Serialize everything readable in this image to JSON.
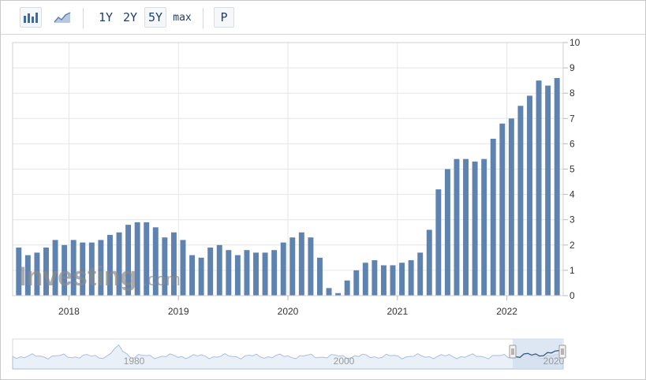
{
  "toolbar": {
    "range_buttons": [
      "1Y",
      "2Y",
      "5Y",
      "max"
    ],
    "active_range": "5Y",
    "print_label": "P"
  },
  "watermark": {
    "brand": "Investing",
    "suffix": ".com"
  },
  "colors": {
    "bar": "#5f83b1",
    "grid": "#e6e6e6",
    "navigator_line": "#a9bfdd",
    "navigator_mask": "#cfdcee",
    "active_button_bg": "#e9eef5"
  },
  "icons": {
    "bar_chart": "bar-chart-icon",
    "line_chart": "line-chart-icon"
  },
  "chart_data": {
    "type": "bar",
    "x": [
      "2017-07",
      "2017-08",
      "2017-09",
      "2017-10",
      "2017-11",
      "2017-12",
      "2018-01",
      "2018-02",
      "2018-03",
      "2018-04",
      "2018-05",
      "2018-06",
      "2018-07",
      "2018-08",
      "2018-09",
      "2018-10",
      "2018-11",
      "2018-12",
      "2019-01",
      "2019-02",
      "2019-03",
      "2019-04",
      "2019-05",
      "2019-06",
      "2019-07",
      "2019-08",
      "2019-09",
      "2019-10",
      "2019-11",
      "2019-12",
      "2020-01",
      "2020-02",
      "2020-03",
      "2020-04",
      "2020-05",
      "2020-06",
      "2020-07",
      "2020-08",
      "2020-09",
      "2020-10",
      "2020-11",
      "2020-12",
      "2021-01",
      "2021-02",
      "2021-03",
      "2021-04",
      "2021-05",
      "2021-06",
      "2021-07",
      "2021-08",
      "2021-09",
      "2021-10",
      "2021-11",
      "2021-12",
      "2022-01",
      "2022-02",
      "2022-03",
      "2022-04",
      "2022-05",
      "2022-06"
    ],
    "values": [
      1.9,
      1.6,
      1.7,
      1.9,
      2.2,
      2.0,
      2.2,
      2.1,
      2.1,
      2.2,
      2.4,
      2.5,
      2.8,
      2.9,
      2.9,
      2.7,
      2.3,
      2.5,
      2.2,
      1.6,
      1.5,
      1.9,
      2.0,
      1.8,
      1.6,
      1.8,
      1.7,
      1.7,
      1.8,
      2.1,
      2.3,
      2.5,
      2.3,
      1.5,
      0.3,
      0.1,
      0.6,
      1.0,
      1.3,
      1.4,
      1.2,
      1.2,
      1.3,
      1.4,
      1.7,
      2.6,
      4.2,
      5.0,
      5.4,
      5.4,
      5.3,
      5.4,
      6.2,
      6.8,
      7.0,
      7.5,
      7.9,
      8.5,
      8.3,
      8.6
    ],
    "xtick_labels": [
      "2018",
      "2019",
      "2020",
      "2021",
      "2022"
    ],
    "ylim": [
      0,
      10
    ],
    "yticks": [
      "0",
      "1",
      "2",
      "3",
      "4",
      "5",
      "6",
      "7",
      "8",
      "9",
      "10"
    ],
    "y_axis_side": "right",
    "grid": true,
    "navigator": {
      "tick_labels": [
        "1980",
        "2000",
        "2020"
      ]
    }
  }
}
